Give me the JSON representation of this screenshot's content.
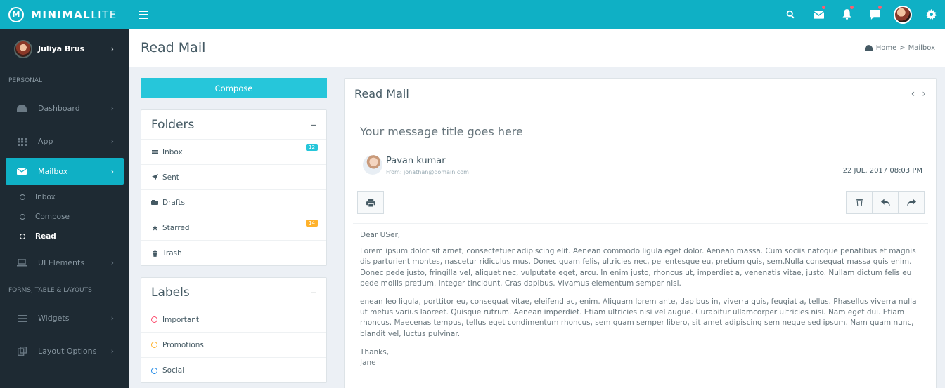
{
  "brand": {
    "bold": "MINIMAL",
    "thin": "LITE",
    "mark": "M"
  },
  "topbar": {
    "icons": [
      "search-icon",
      "mail-icon",
      "bell-icon",
      "chat-icon",
      "settings-icon"
    ]
  },
  "sidebar": {
    "user_name": "Juliya Brus",
    "section_personal": "PERSONAL",
    "items": [
      {
        "label": "Dashboard",
        "icon": "dashboard-icon"
      },
      {
        "label": "App",
        "icon": "grid-icon"
      },
      {
        "label": "Mailbox",
        "icon": "mail-icon"
      },
      {
        "label": "UI Elements",
        "icon": "laptop-icon"
      },
      {
        "label": "Widgets",
        "icon": "list-icon"
      },
      {
        "label": "Layout Options",
        "icon": "layout-icon"
      }
    ],
    "sub_items": [
      "Inbox",
      "Compose",
      "Read"
    ],
    "section_forms": "FORMS, TABLE & LAYOUTS"
  },
  "page": {
    "title": "Read Mail",
    "breadcrumb": {
      "home": "Home",
      "separator": ">",
      "current": "Mailbox"
    }
  },
  "compose_label": "Compose",
  "folders": {
    "title": "Folders",
    "collapse": "–",
    "items": [
      {
        "label": "Inbox",
        "icon": "inbox-icon",
        "badge": "12"
      },
      {
        "label": "Sent",
        "icon": "send-icon",
        "badge": ""
      },
      {
        "label": "Drafts",
        "icon": "draft-icon",
        "badge": ""
      },
      {
        "label": "Starred",
        "icon": "star-icon",
        "badge": "14"
      },
      {
        "label": "Trash",
        "icon": "trash-icon",
        "badge": ""
      }
    ]
  },
  "labels": {
    "title": "Labels",
    "collapse": "–",
    "items": [
      {
        "label": "Important",
        "color": "#fc4b6c"
      },
      {
        "label": "Promotions",
        "color": "#ffb22b"
      },
      {
        "label": "Social",
        "color": "#1e88e5"
      }
    ]
  },
  "mail": {
    "header": "Read Mail",
    "prev": "‹",
    "next": "›",
    "subject": "Your message title goes here",
    "sender_name": "Pavan kumar",
    "sender_from": "From: jonathan@domain.com",
    "date": "22 JUL. 2017 08:03 PM",
    "greeting": "Dear USer,",
    "paragraph1": "Lorem ipsum dolor sit amet, consectetuer adipiscing elit. Aenean commodo ligula eget dolor. Aenean massa. Cum sociis natoque penatibus et magnis dis parturient montes, nascetur ridiculus mus. Donec quam felis, ultricies nec, pellentesque eu, pretium quis, sem.Nulla consequat massa quis enim. Donec pede justo, fringilla vel, aliquet nec, vulputate eget, arcu. In enim justo, rhoncus ut, imperdiet a, venenatis vitae, justo. Nullam dictum felis eu pede mollis pretium. Integer tincidunt. Cras dapibus. Vivamus elementum semper nisi.",
    "paragraph2": "enean leo ligula, porttitor eu, consequat vitae, eleifend ac, enim. Aliquam lorem ante, dapibus in, viverra quis, feugiat a, tellus. Phasellus viverra nulla ut metus varius laoreet. Quisque rutrum. Aenean imperdiet. Etiam ultricies nisi vel augue. Curabitur ullamcorper ultricies nisi. Nam eget dui. Etiam rhoncus. Maecenas tempus, tellus eget condimentum rhoncus, sem quam semper libero, sit amet adipiscing sem neque sed ipsum. Nam quam nunc, blandit vel, luctus pulvinar.",
    "signoff": "Thanks,",
    "signature": "Jane"
  },
  "colors": {
    "accent": "#0fb0c5",
    "compose": "#26c6da",
    "sidebar": "#1e2a33"
  }
}
